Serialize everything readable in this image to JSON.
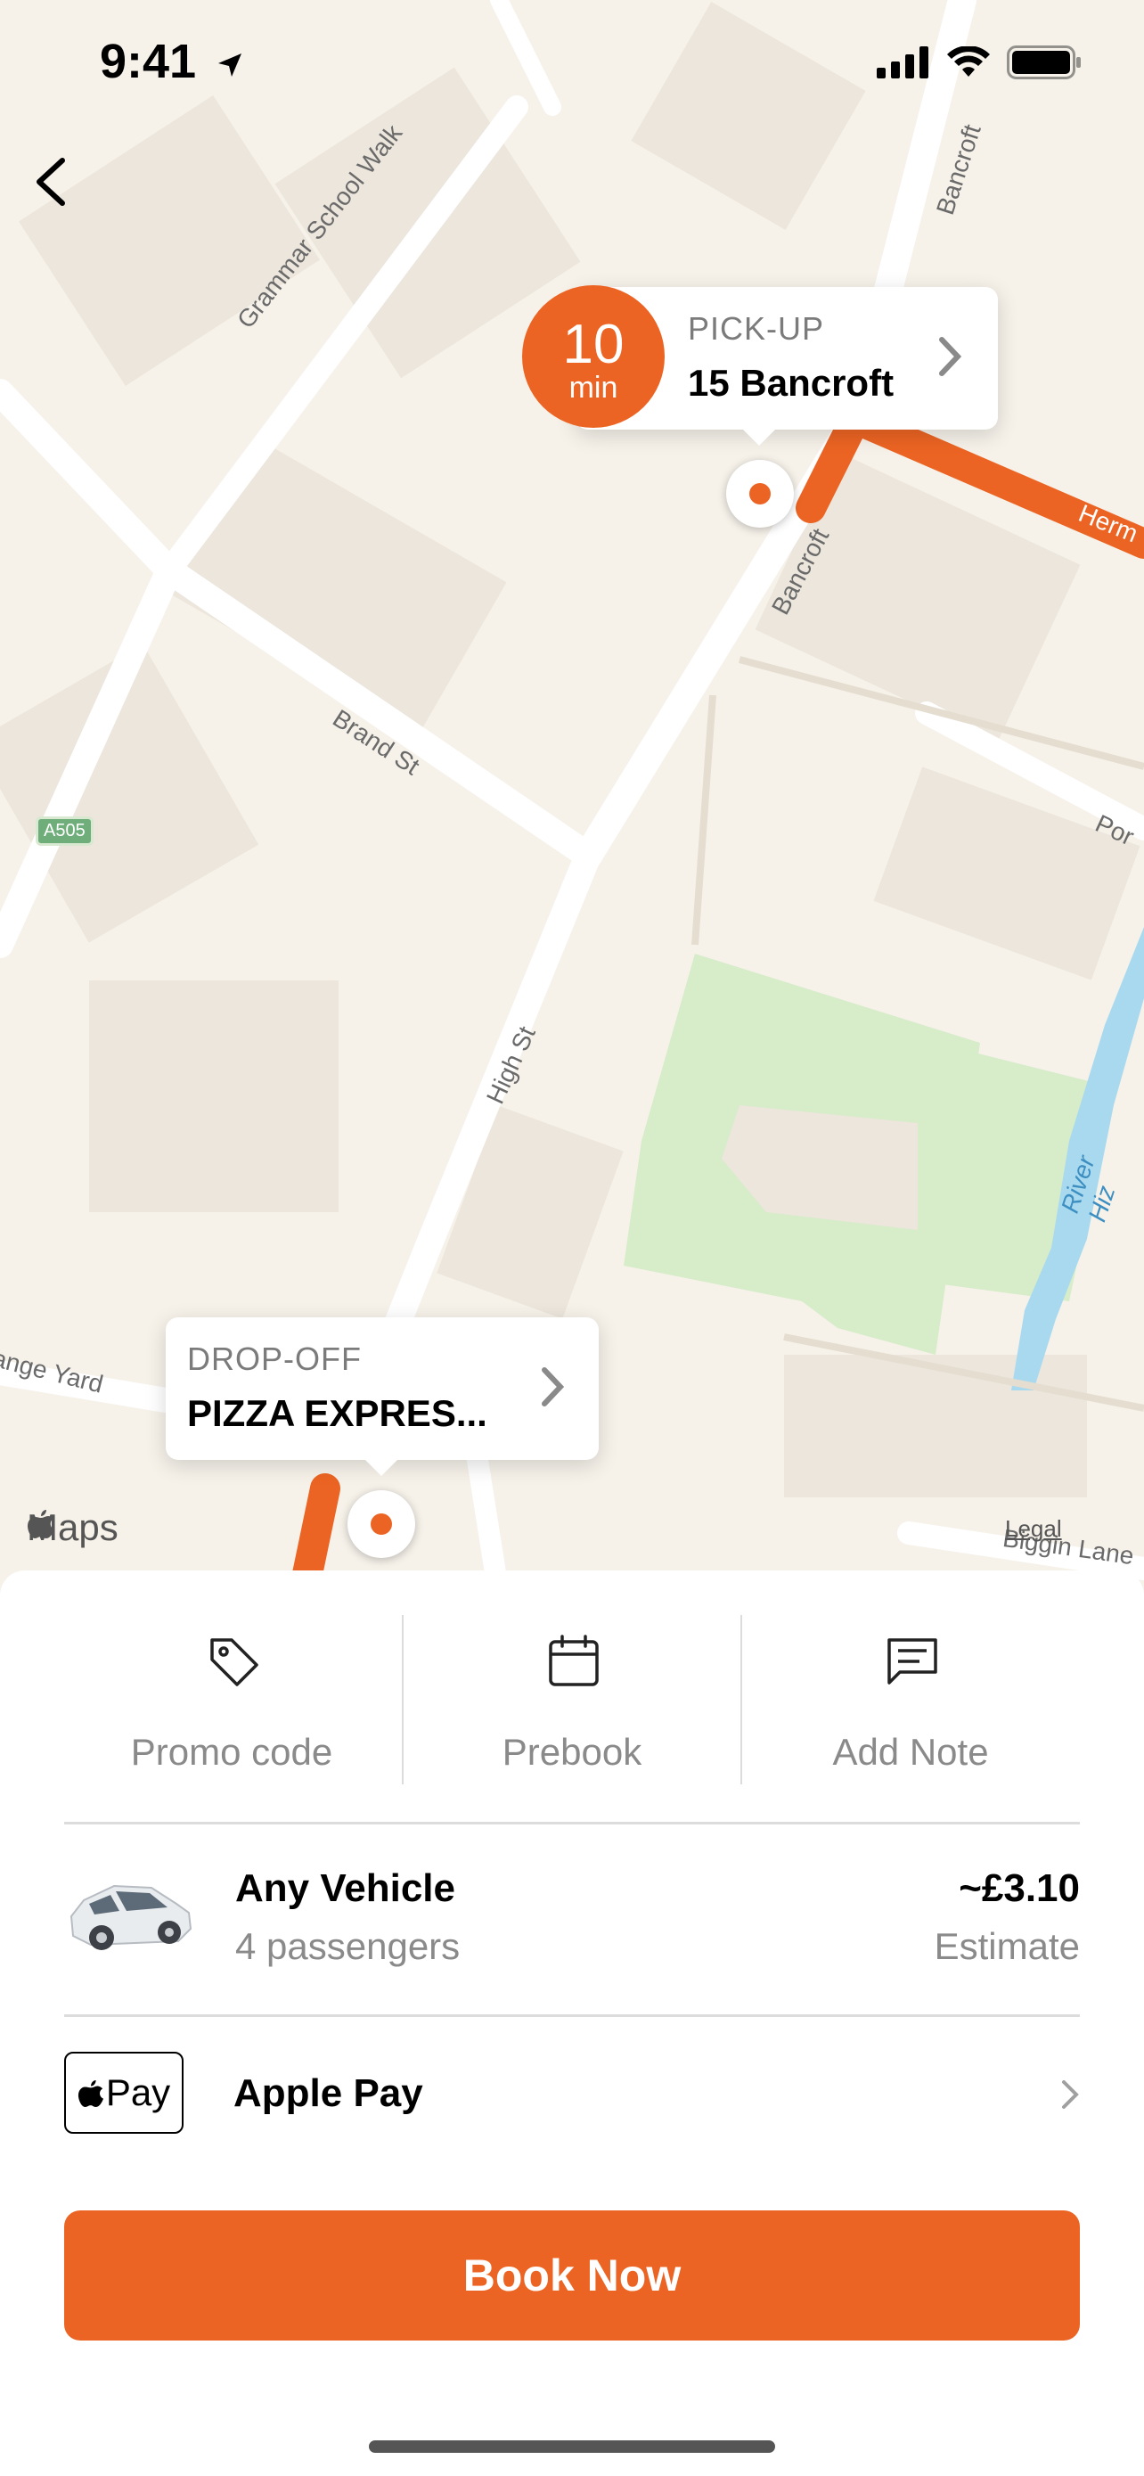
{
  "status_bar": {
    "time": "9:41"
  },
  "map": {
    "street_labels": {
      "grammar_school_walk": "Grammar School Walk",
      "bancroft_top": "Bancroft",
      "bancroft_mid": "Bancroft",
      "brand_st": "Brand St",
      "high_st": "High St",
      "river_hiz": "River Hiz",
      "a505": "A505",
      "grange_yard": "ange Yard",
      "biggin_lane": "Biggin Lane",
      "hermitage": "Herm",
      "port": "Por"
    },
    "maps_attribution": "Maps",
    "legal": "Legal",
    "pickup": {
      "eta_value": "10",
      "eta_unit": "min",
      "label": "PICK-UP",
      "address": "15 Bancroft"
    },
    "dropoff": {
      "label": "DROP-OFF",
      "address": "PIZZA EXPRES..."
    }
  },
  "actions": {
    "promo_code": "Promo code",
    "prebook": "Prebook",
    "add_note": "Add Note"
  },
  "vehicle": {
    "name": "Any Vehicle",
    "passengers": "4 passengers",
    "price": "~£3.10",
    "price_note": "Estimate"
  },
  "payment": {
    "badge": "Pay",
    "label": "Apple Pay"
  },
  "book_button": "Book Now",
  "colors": {
    "accent": "#ec6423",
    "map_bg": "#f6f2ea",
    "road": "#ffffff",
    "park": "#d7ecc9",
    "water": "#a9d9ef"
  }
}
